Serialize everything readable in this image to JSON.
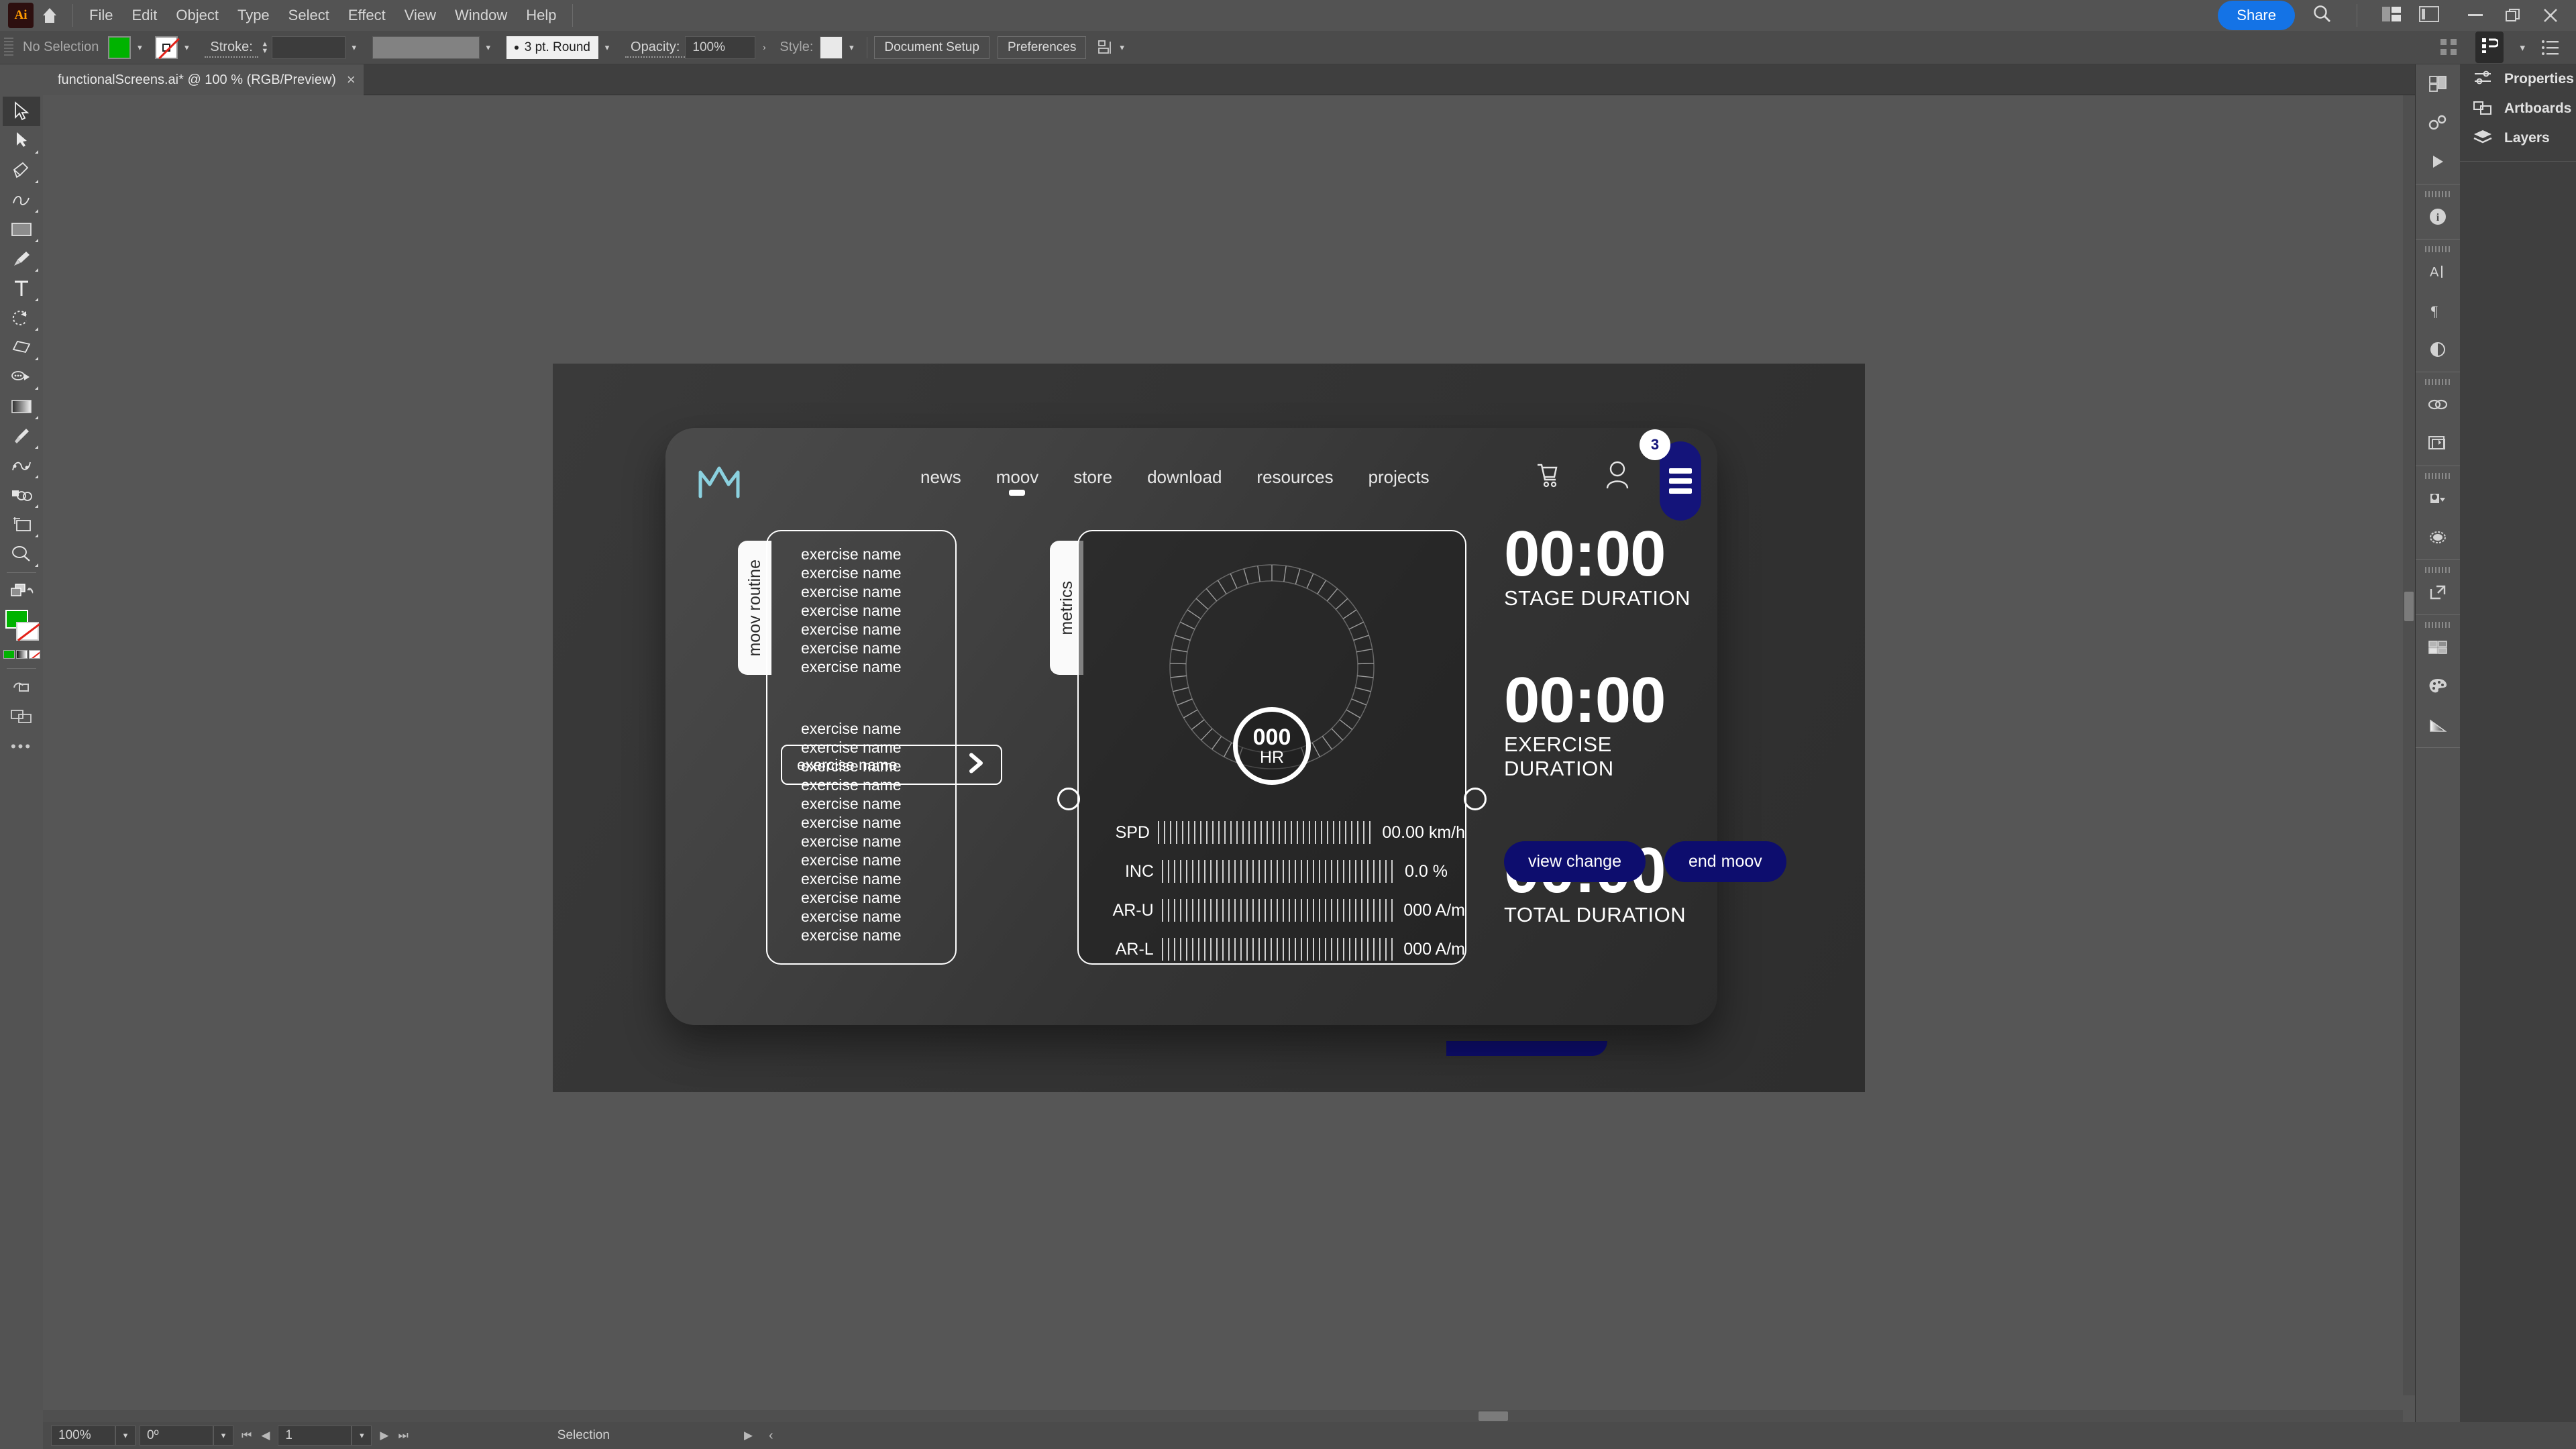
{
  "app": {
    "name": "Adobe Illustrator",
    "logo_text": "Ai"
  },
  "menubar": {
    "items": [
      "File",
      "Edit",
      "Object",
      "Type",
      "Select",
      "Effect",
      "View",
      "Window",
      "Help"
    ],
    "share_label": "Share"
  },
  "controlbar": {
    "selection_status": "No Selection",
    "fill_color": "#00b300",
    "stroke_label": "Stroke:",
    "stroke_profile": "3 pt. Round",
    "opacity_label": "Opacity:",
    "opacity_value": "100%",
    "style_label": "Style:",
    "document_setup": "Document Setup",
    "preferences": "Preferences"
  },
  "document_tab": {
    "title": "functionalScreens.ai* @ 100 % (RGB/Preview)",
    "close": "×"
  },
  "toolbar": {
    "tools": [
      "selection-tool",
      "direct-selection-tool",
      "pen-tool",
      "curvature-tool",
      "rectangle-tool",
      "paintbrush-tool",
      "type-tool",
      "rotate-tool",
      "shape-builder-tool",
      "width-tool",
      "gradient-tool",
      "eyedropper-tool",
      "blend-tool",
      "symbol-sprayer-tool",
      "artboard-tool",
      "zoom-tool"
    ]
  },
  "right_panels": {
    "items": [
      {
        "label": "Properties",
        "icon": "sliders-icon"
      },
      {
        "label": "Artboards",
        "icon": "artboards-icon"
      },
      {
        "label": "Layers",
        "icon": "layers-icon"
      }
    ],
    "rail_icons": [
      "libraries-icon",
      "actions-icon",
      "play-icon",
      "info-icon",
      "character-icon",
      "paragraph-icon",
      "opacity-icon",
      "links-icon",
      "asset-export-icon",
      "image-trace-icon",
      "transparency-icon",
      "export-icon",
      "swatches-icon",
      "color-icon",
      "gradient-icon"
    ]
  },
  "statusbar": {
    "zoom": "100%",
    "rotation": "0º",
    "artboard_number": "1",
    "tool_status": "Selection"
  },
  "design": {
    "nav": {
      "items": [
        {
          "label": "news",
          "active": false
        },
        {
          "label": "moov",
          "active": true
        },
        {
          "label": "store",
          "active": false
        },
        {
          "label": "download",
          "active": false
        },
        {
          "label": "resources",
          "active": false
        },
        {
          "label": "projects",
          "active": false
        }
      ],
      "cart_badge": "3"
    },
    "routine": {
      "tab_label": "moov routine",
      "items_before": [
        "exercise name",
        "exercise name",
        "exercise name",
        "exercise name",
        "exercise name",
        "exercise name",
        "exercise name"
      ],
      "selected_item": "exercise name",
      "items_after": [
        "exercise name",
        "exercise name",
        "exercise name",
        "exercise name",
        "exercise name",
        "exercise name",
        "exercise name",
        "exercise name",
        "exercise name",
        "exercise name",
        "exercise name",
        "exercise name"
      ]
    },
    "metrics": {
      "tab_label": "metrics",
      "hr_value": "000",
      "hr_unit": "HR",
      "rows": [
        {
          "key": "SPD",
          "value": "00.00 km/h"
        },
        {
          "key": "INC",
          "value": "0.0 %"
        },
        {
          "key": "AR-U",
          "value": "000 A/m"
        },
        {
          "key": "AR-L",
          "value": "000 A/m"
        }
      ]
    },
    "durations": [
      {
        "time": "00:00",
        "label": "STAGE DURATION"
      },
      {
        "time": "00:00",
        "label": "EXERCISE DURATION"
      },
      {
        "time": "00:00",
        "label": "TOTAL DURATION"
      }
    ],
    "actions": [
      {
        "label": "view change"
      },
      {
        "label": "end moov"
      }
    ],
    "colors": {
      "accent_blue": "#0d0d6e",
      "menu_blue": "#14147a",
      "card_dark": "#2b2b2b",
      "text_white": "#ffffff"
    }
  }
}
